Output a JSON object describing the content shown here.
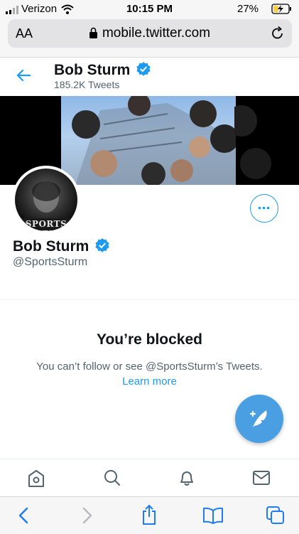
{
  "status": {
    "carrier": "Verizon",
    "time": "10:15 PM",
    "battery": "27%"
  },
  "browser": {
    "text_size_label": "AA",
    "url": "mobile.twitter.com"
  },
  "header": {
    "name": "Bob Sturm",
    "tweet_count": "185.2K Tweets"
  },
  "profile": {
    "avatar_text": "SPORTS STU",
    "name": "Bob Sturm",
    "handle": "@SportsSturm"
  },
  "blocked": {
    "title": "You’re blocked",
    "message": "You can’t follow or see @SportsSturm’s Tweets.",
    "learn_more": "Learn more"
  },
  "tabs": [
    {
      "icon": "home-icon"
    },
    {
      "icon": "search-icon"
    },
    {
      "icon": "notifications-icon"
    },
    {
      "icon": "messages-icon"
    }
  ],
  "safari": [
    {
      "icon": "back-icon"
    },
    {
      "icon": "forward-icon"
    },
    {
      "icon": "share-icon"
    },
    {
      "icon": "bookmarks-icon"
    },
    {
      "icon": "tabs-icon"
    }
  ],
  "colors": {
    "accent": "#1d9bf0",
    "fab": "#4a9fe3",
    "battery": "#f7d23e"
  }
}
